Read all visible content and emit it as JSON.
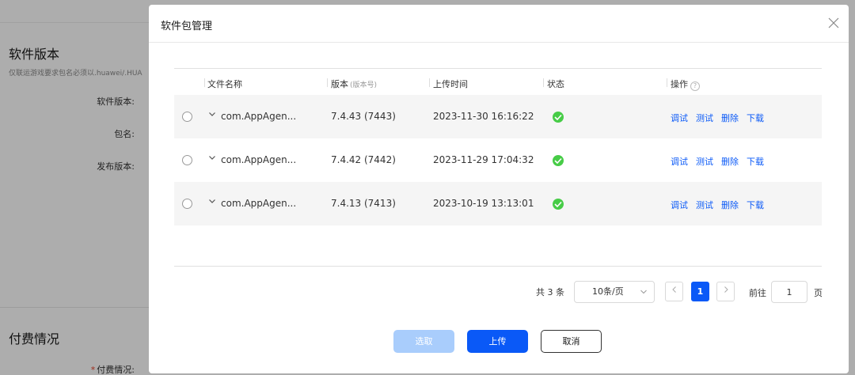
{
  "background": {
    "section1_title": "软件版本",
    "hint": "仅联运游戏要求包名必须以.huawei/.HUA",
    "labels": [
      "软件版本:",
      "包名:",
      "发布版本:"
    ],
    "section2_title": "付费情况",
    "paid_label": "付费情况:",
    "paid_required": "*"
  },
  "modal": {
    "title": "软件包管理",
    "columns": {
      "name": "文件名称",
      "version": "版本",
      "version_sub": "(版本号)",
      "upload_time": "上传时间",
      "status": "状态",
      "actions": "操作",
      "actions_help": "?"
    },
    "rows": [
      {
        "name": "com.AppAgen...",
        "version": "7.4.43 (7443)",
        "time": "2023-11-30 16:16:22",
        "status": "success"
      },
      {
        "name": "com.AppAgen...",
        "version": "7.4.42 (7442)",
        "time": "2023-11-29 17:04:32",
        "status": "success"
      },
      {
        "name": "com.AppAgen...",
        "version": "7.4.13 (7413)",
        "time": "2023-10-19 13:13:01",
        "status": "success"
      }
    ],
    "row_actions": [
      "调试",
      "测试",
      "删除",
      "下载"
    ],
    "pagination": {
      "total": "共 3 条",
      "page_size": "10条/页",
      "current_page": "1",
      "goto_label": "前往",
      "goto_value": "1",
      "goto_unit": "页"
    },
    "buttons": {
      "select": "选取",
      "upload": "上传",
      "cancel": "取消"
    }
  },
  "colors": {
    "accent": "#0a59f7",
    "accent_disabled": "#a9cdfc",
    "success": "#47cc47",
    "overlay": "rgba(0,0,0,0.32)"
  }
}
